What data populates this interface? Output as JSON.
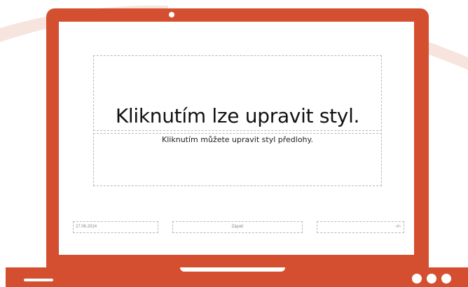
{
  "slide": {
    "title": "Kliknutím lze upravit styl.",
    "subtitle": "Kliknutím můžete upravit styl předlohy.",
    "date": "27.06.2024",
    "footer": "Zápatí",
    "slide_number": "‹#›"
  },
  "colors": {
    "device": "#d44f2f",
    "background": "#ffffff",
    "swoosh": "#f7e4de"
  }
}
